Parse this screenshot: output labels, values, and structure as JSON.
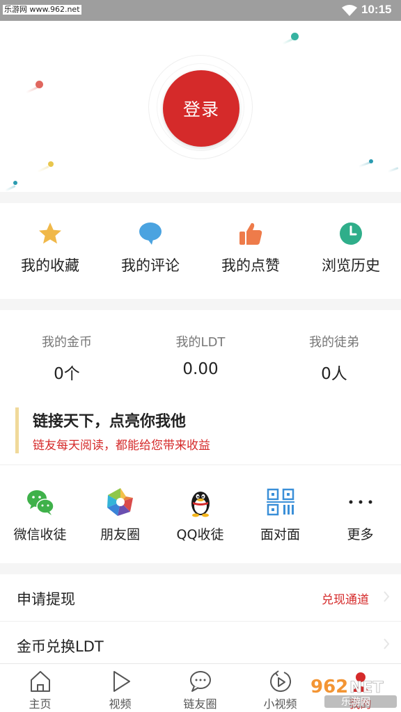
{
  "status_bar": {
    "watermark": "乐游网 www.962.net",
    "time": "10:15"
  },
  "header": {
    "login_label": "登录"
  },
  "quick_actions": [
    {
      "label": "我的收藏",
      "icon": "star-icon",
      "color": "#f0b849"
    },
    {
      "label": "我的评论",
      "icon": "comment-bubble-icon",
      "color": "#4aa3e0"
    },
    {
      "label": "我的点赞",
      "icon": "thumbs-up-icon",
      "color": "#ee7b4a"
    },
    {
      "label": "浏览历史",
      "icon": "clock-icon",
      "color": "#2fae8a"
    }
  ],
  "stats": [
    {
      "title": "我的金币",
      "value": "0个"
    },
    {
      "title": "我的LDT",
      "value": "0.00"
    },
    {
      "title": "我的徒弟",
      "value": "0人"
    }
  ],
  "slogan": {
    "title": "链接天下，点亮你我他",
    "subtitle": "链友每天阅读，都能给您带来收益"
  },
  "share_actions": [
    {
      "label": "微信收徒",
      "icon": "wechat-icon"
    },
    {
      "label": "朋友圈",
      "icon": "moments-icon"
    },
    {
      "label": "QQ收徒",
      "icon": "qq-penguin-icon"
    },
    {
      "label": "面对面",
      "icon": "qr-code-icon"
    },
    {
      "label": "更多",
      "icon": "more-dots-icon"
    }
  ],
  "list_rows": [
    {
      "label": "申请提现",
      "right_label": "兑现通道"
    },
    {
      "label": "金币兑换LDT",
      "right_label": ""
    }
  ],
  "bottom_nav": [
    {
      "label": "主页",
      "icon": "home-icon"
    },
    {
      "label": "视频",
      "icon": "play-icon"
    },
    {
      "label": "链友圈",
      "icon": "chat-bubble-icon"
    },
    {
      "label": "小视频",
      "icon": "short-video-icon"
    },
    {
      "label": "我的",
      "icon": "profile-icon"
    }
  ],
  "bottom_watermark": "962NET 乐游网",
  "colors": {
    "accent": "#d52a2a",
    "slogan_bar": "#f0d99a",
    "status_bar": "#9e9e9e"
  }
}
